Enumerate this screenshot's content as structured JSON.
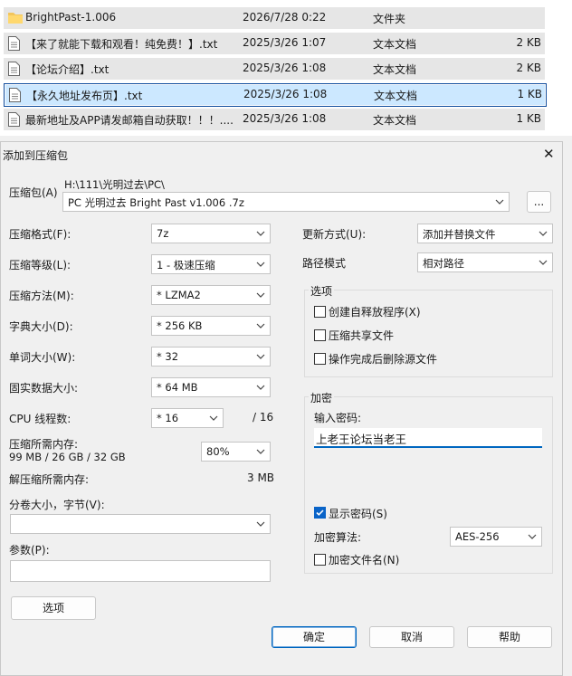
{
  "file_list": [
    {
      "name": "BrightPast-1.006",
      "date": "2026/7/28 0:22",
      "type": "文件夹",
      "size": "",
      "icon": "folder-icon"
    },
    {
      "name": "【来了就能下载和观看！纯免费！】.txt",
      "date": "2025/3/26 1:07",
      "type": "文本文档",
      "size": "2 KB",
      "icon": "text-file-icon"
    },
    {
      "name": "【论坛介绍】.txt",
      "date": "2025/3/26 1:08",
      "type": "文本文档",
      "size": "2 KB",
      "icon": "text-file-icon"
    },
    {
      "name": "【永久地址发布页】.txt",
      "date": "2025/3/26 1:08",
      "type": "文本文档",
      "size": "1 KB",
      "icon": "text-file-icon"
    },
    {
      "name": "最新地址及APP请发邮箱自动获取！！！....",
      "date": "2025/3/26 1:08",
      "type": "文本文档",
      "size": "1 KB",
      "icon": "text-file-icon"
    }
  ],
  "dialog": {
    "title": "添加到压缩包",
    "close_glyph": "✕",
    "archive": {
      "label": "压缩包(A)",
      "path": "H:\\111\\光明过去\\PC\\",
      "name": "PC 光明过去 Bright Past v1.006 .7z",
      "browse_label": "..."
    },
    "left": {
      "format": {
        "label": "压缩格式(F):",
        "value": "7z"
      },
      "level": {
        "label": "压缩等级(L):",
        "value": "1 - 极速压缩"
      },
      "method": {
        "label": "压缩方法(M):",
        "value": "*  LZMA2"
      },
      "dict": {
        "label": "字典大小(D):",
        "value": "*  256 KB"
      },
      "word": {
        "label": "单词大小(W):",
        "value": "*  32"
      },
      "solid": {
        "label": "固实数据大小:",
        "value": "*  64 MB"
      },
      "cpu": {
        "label": "CPU 线程数:",
        "value": "*  16",
        "total": "/ 16"
      },
      "mem_comp": {
        "label": "压缩所需内存:",
        "detail": "99 MB / 26 GB / 32 GB",
        "value": "80%"
      },
      "mem_decomp": {
        "label": "解压缩所需内存:",
        "value": "3 MB"
      },
      "volume": {
        "label": "分卷大小，字节(V):",
        "value": ""
      },
      "params": {
        "label": "参数(P):",
        "value": ""
      },
      "options_button": "选项"
    },
    "right": {
      "update": {
        "label": "更新方式(U):",
        "value": "添加并替换文件"
      },
      "path_mode": {
        "label": "路径模式",
        "value": "相对路径"
      },
      "options_group": {
        "title": "选项",
        "sfx": {
          "label": "创建自释放程序(X)",
          "checked": false
        },
        "shared": {
          "label": "压缩共享文件",
          "checked": false
        },
        "delete": {
          "label": "操作完成后删除源文件",
          "checked": false
        }
      },
      "encryption_group": {
        "title": "加密",
        "password_label": "输入密码:",
        "password_value": "上老王论坛当老王",
        "show_password": {
          "label": "显示密码(S)",
          "checked": true
        },
        "method_label": "加密算法:",
        "method_value": "AES-256",
        "encrypt_names": {
          "label": "加密文件名(N)",
          "checked": false
        }
      }
    },
    "buttons": {
      "ok": "确定",
      "cancel": "取消",
      "help": "帮助"
    }
  },
  "colors": {
    "accent": "#0067c0",
    "selection": "#cce8ff",
    "row_bg": "#e6e6e6",
    "dialog_bg": "#f0f0f0"
  }
}
